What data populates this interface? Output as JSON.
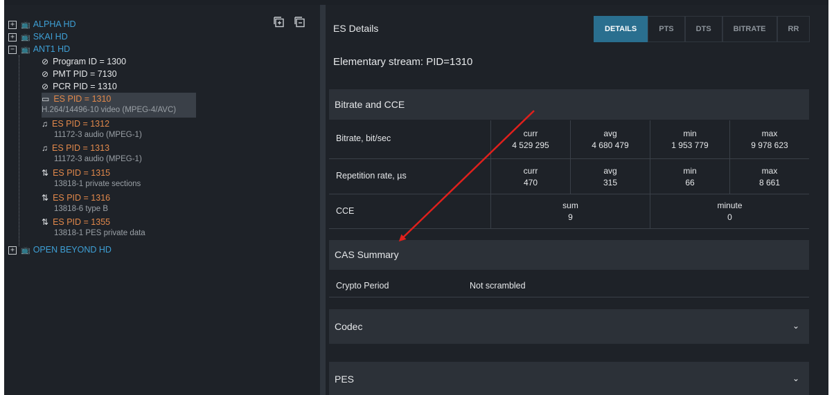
{
  "tree": {
    "services": [
      {
        "label": "ALPHA HD",
        "expander": "+"
      },
      {
        "label": "SKAI HD",
        "expander": "+"
      },
      {
        "label": "ANT1 HD",
        "expander": "−"
      },
      {
        "label": "OPEN BEYOND HD",
        "expander": "+"
      }
    ],
    "ant1_children": [
      {
        "label": "Program ID = 1300",
        "icon": "tag-icon",
        "color": "#e6e8ea"
      },
      {
        "label": "PMT PID = 7130",
        "icon": "tag-icon",
        "color": "#e6e8ea"
      },
      {
        "label": "PCR PID = 1310",
        "icon": "tag-icon",
        "color": "#e6e8ea"
      },
      {
        "label": "ES PID = 1310",
        "sub": "H.264/14496-10 video (MPEG-4/AVC)",
        "icon": "video-icon",
        "selected": true
      },
      {
        "label": "ES PID = 1312",
        "sub": "11172-3 audio (MPEG-1)",
        "icon": "audio-icon"
      },
      {
        "label": "ES PID = 1313",
        "sub": "11172-3 audio (MPEG-1)",
        "icon": "audio-icon"
      },
      {
        "label": "ES PID = 1315",
        "sub": "13818-1 private sections",
        "icon": "data-icon"
      },
      {
        "label": "ES PID = 1316",
        "sub": "13818-6 type B",
        "icon": "data-icon"
      },
      {
        "label": "ES PID = 1355",
        "sub": "13818-1 PES private data",
        "icon": "data-icon"
      }
    ]
  },
  "toolbar": {
    "icons": [
      "expand-all-icon",
      "collapse-all-icon"
    ]
  },
  "details": {
    "title": "ES Details",
    "tabs": [
      "DETAILS",
      "PTS",
      "DTS",
      "BITRATE",
      "RR"
    ],
    "active_tab": "DETAILS",
    "stream_title": "Elementary stream: PID=1310",
    "bitrate_section": "Bitrate and CCE",
    "rows": {
      "bitrate": {
        "label": "Bitrate, bit/sec",
        "curr_h": "curr",
        "curr": "4 529 295",
        "avg_h": "avg",
        "avg": "4 680 479",
        "min_h": "min",
        "min": "1 953 779",
        "max_h": "max",
        "max": "9 978 623"
      },
      "rr": {
        "label": "Repetition rate, µs",
        "curr_h": "curr",
        "curr": "470",
        "avg_h": "avg",
        "avg": "315",
        "min_h": "min",
        "min": "66",
        "max_h": "max",
        "max": "8 661"
      },
      "cce": {
        "label": "CCE",
        "sum_h": "sum",
        "sum": "9",
        "minute_h": "minute",
        "minute": "0"
      }
    },
    "cas_section": "CAS Summary",
    "cas": {
      "key": "Crypto Period",
      "value": "Not scrambled"
    },
    "codec_section": "Codec",
    "pes_section": "PES"
  },
  "colors": {
    "accent": "#2a6f8f",
    "link": "#3ea0d6",
    "es": "#e3894b",
    "arrow": "#e0201c"
  }
}
